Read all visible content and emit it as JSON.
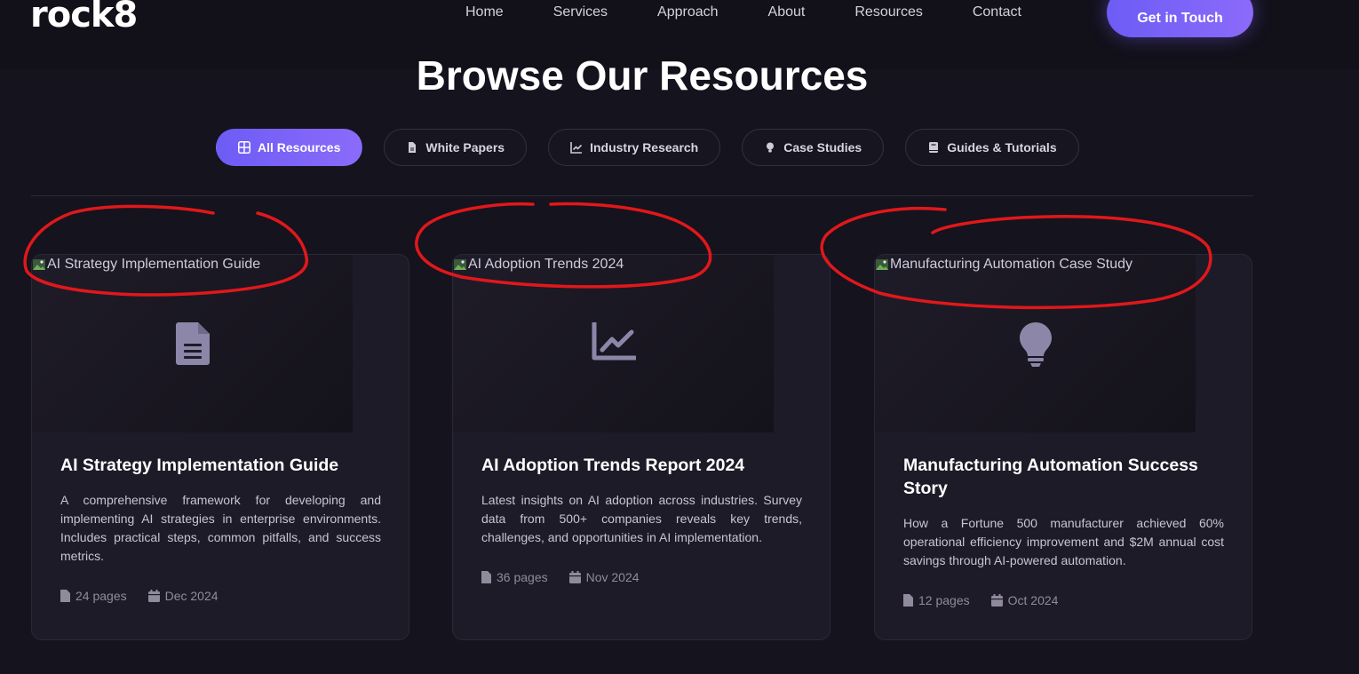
{
  "brand": {
    "logo": "rock8"
  },
  "nav": {
    "links": [
      "Home",
      "Services",
      "Approach",
      "About",
      "Resources",
      "Contact"
    ],
    "cta": "Get in Touch"
  },
  "page": {
    "heading": "Browse Our Resources"
  },
  "filters": [
    {
      "label": "All Resources",
      "icon": "grid-icon",
      "active": true
    },
    {
      "label": "White Papers",
      "icon": "file-icon",
      "active": false
    },
    {
      "label": "Industry Research",
      "icon": "chart-line-icon",
      "active": false
    },
    {
      "label": "Case Studies",
      "icon": "lightbulb-icon",
      "active": false
    },
    {
      "label": "Guides & Tutorials",
      "icon": "book-icon",
      "active": false
    }
  ],
  "cards": [
    {
      "image_alt": "AI Strategy Implementation Guide",
      "icon": "document-icon",
      "title": "AI Strategy Implementation Guide",
      "description": "A comprehensive framework for developing and implementing AI strategies in enterprise environments. Includes practical steps, common pitfalls, and success metrics.",
      "pages": "24 pages",
      "date": "Dec 2024"
    },
    {
      "image_alt": "AI Adoption Trends 2024",
      "icon": "chart-line-icon",
      "title": "AI Adoption Trends Report 2024",
      "description": "Latest insights on AI adoption across industries. Survey data from 500+ companies reveals key trends, challenges, and opportunities in AI implementation.",
      "pages": "36 pages",
      "date": "Nov 2024"
    },
    {
      "image_alt": "Manufacturing Automation Case Study",
      "icon": "lightbulb-icon",
      "title": "Manufacturing Automation Success Story",
      "description": "How a Fortune 500 manufacturer achieved 60% operational efficiency improvement and $2M annual cost savings through AI-powered automation.",
      "pages": "12 pages",
      "date": "Oct 2024"
    }
  ],
  "colors": {
    "accent": "#7a63f7",
    "background": "#15131d",
    "card": "#1e1b28",
    "annotation": "#e0181b"
  }
}
